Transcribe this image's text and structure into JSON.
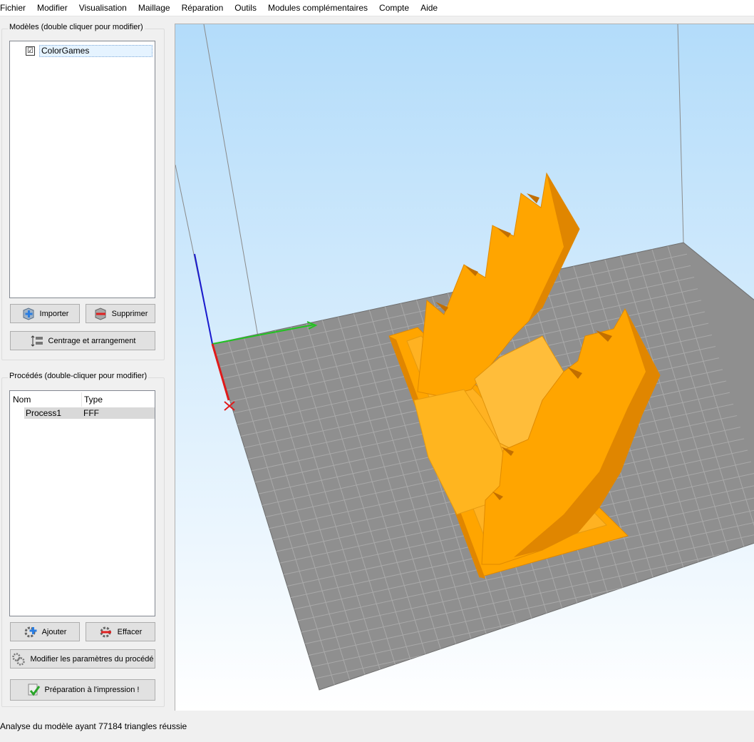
{
  "menu": [
    "Fichier",
    "Modifier",
    "Visualisation",
    "Maillage",
    "Réparation",
    "Outils",
    "Modules complémentaires",
    "Compte",
    "Aide"
  ],
  "models": {
    "title": "Modèles (double cliquer pour modifier)",
    "items": [
      {
        "label": "ColorGames",
        "checked": "☑"
      }
    ],
    "import_label": "Importer",
    "delete_label": "Supprimer",
    "arrange_label": "Centrage et arrangement"
  },
  "processes": {
    "title": "Procédés (double-cliquer pour modifier)",
    "columns": [
      "Nom",
      "Type"
    ],
    "rows": [
      {
        "name": "Process1",
        "type": "FFF"
      }
    ],
    "add_label": "Ajouter",
    "delete_label": "Effacer",
    "edit_label": "Modifier les paramètres du procédé",
    "prepare_label": "Préparation à l'impression !"
  },
  "status": "Analyse du modèle ayant 77184 triangles réussie",
  "colors": {
    "model": "#ffa500",
    "model_shade": "#e08600",
    "bed": "#8f8f8f",
    "grid": "#a8a8a8",
    "sky_top": "#b3dcfa",
    "sky_bottom": "#ffffff"
  },
  "icons": [
    "import-icon",
    "delete-model-icon",
    "arrange-icon",
    "add-process-icon",
    "delete-process-icon",
    "process-settings-icon",
    "prepare-print-icon"
  ]
}
